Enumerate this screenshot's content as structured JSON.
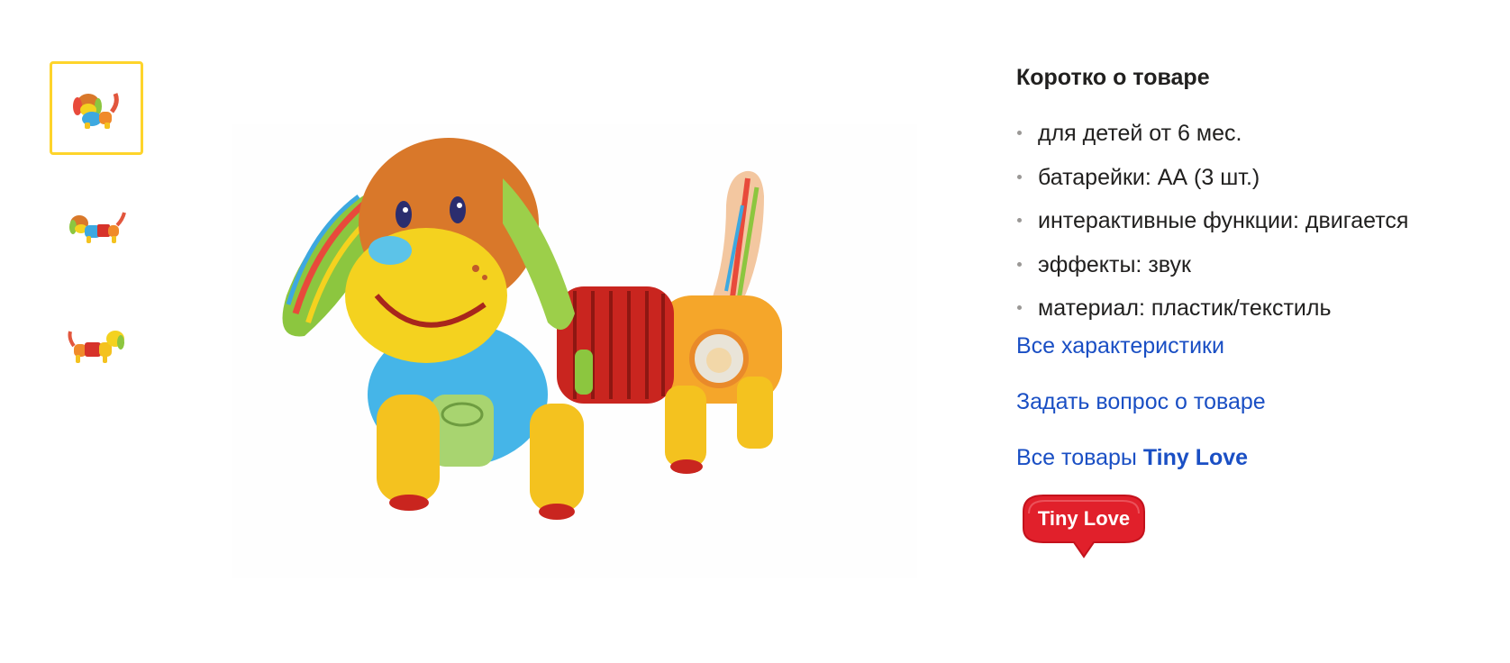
{
  "gallery": {
    "thumbnails": [
      {
        "alt": "dog-toy-front-view",
        "active": true
      },
      {
        "alt": "dog-toy-side-view",
        "active": false
      },
      {
        "alt": "dog-toy-back-view",
        "active": false
      }
    ],
    "main_image_alt": "dog-toy-main-photo"
  },
  "summary": {
    "title": "Коротко о товаре",
    "specs": [
      "для детей от 6 мес.",
      "батарейки: АА (3 шт.)",
      "интерактивные функции: двигается",
      "эффекты: звук",
      "материал: пластик/текстиль"
    ],
    "all_characteristics_link": "Все характеристики",
    "ask_question_link": "Задать вопрос о товаре",
    "brand_link_prefix": "Все товары",
    "brand_name": "Tiny Love",
    "brand_logo_text": "Tiny Love"
  },
  "colors": {
    "link": "#1a4fc4",
    "active_thumb_border": "#fed42b",
    "text": "#21201f",
    "bullet": "#9a9896",
    "logo_red": "#e1202b"
  }
}
